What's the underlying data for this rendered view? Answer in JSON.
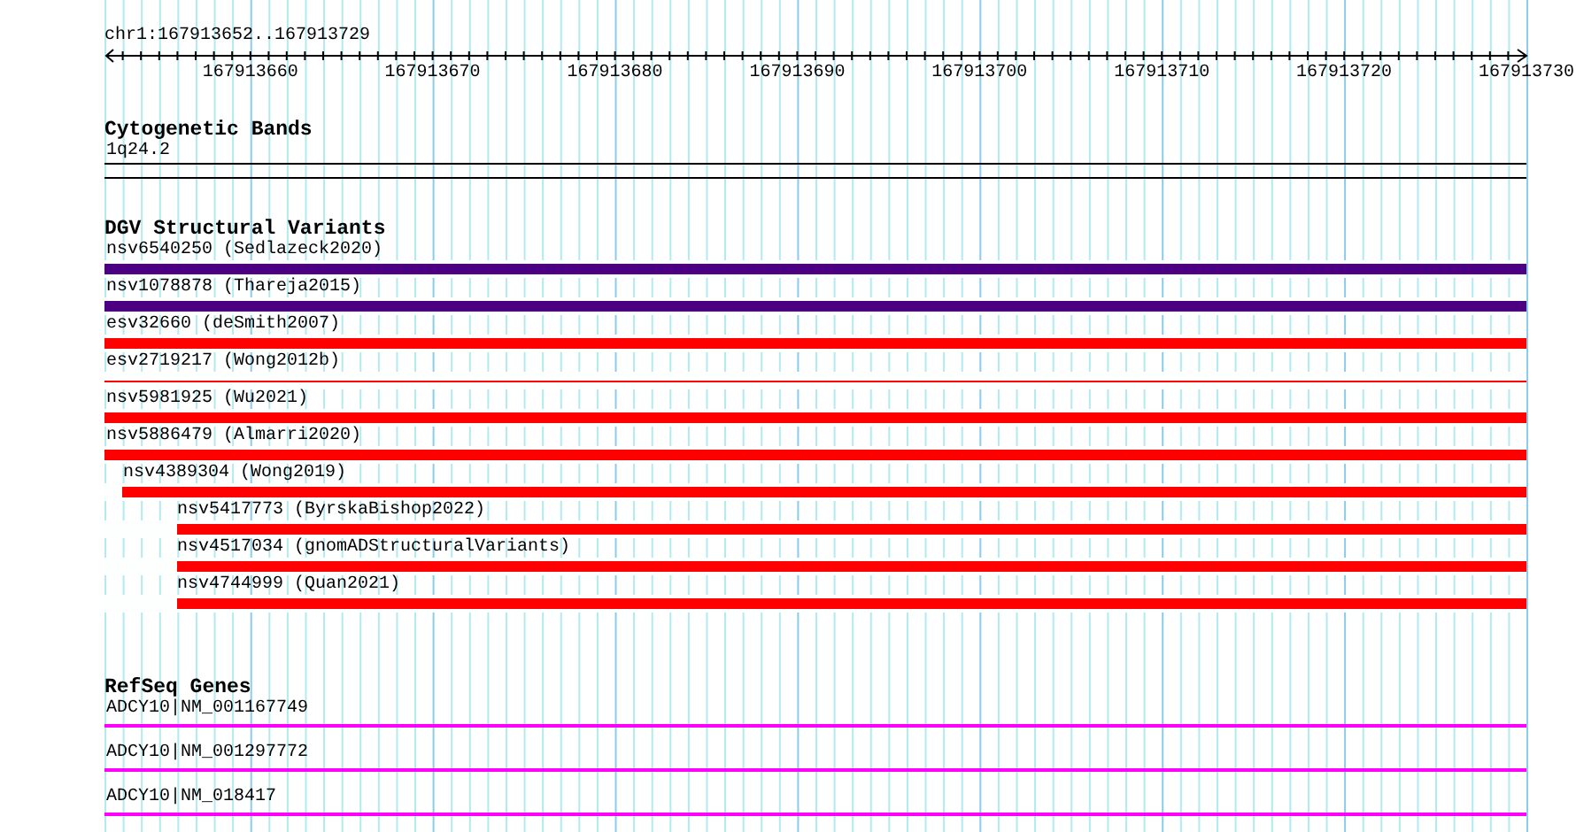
{
  "ruler": {
    "label": "chr1:167913652..167913729",
    "ticks": [
      "167913660",
      "167913670",
      "167913680",
      "167913690",
      "167913700",
      "167913710",
      "167913720",
      "167913730"
    ]
  },
  "tracks": [
    {
      "title": "Cytogenetic Bands",
      "kind": "bands",
      "features": [
        {
          "label": "1q24.2"
        }
      ]
    },
    {
      "title": "DGV Structural Variants",
      "kind": "variants",
      "features": [
        {
          "label": "nsv6540250 (Sedlazeck2020)",
          "kind": "thick",
          "color": "#4b0082"
        },
        {
          "label": "nsv1078878 (Thareja2015)",
          "kind": "thick",
          "color": "#4b0082"
        },
        {
          "label": "esv32660 (deSmith2007)",
          "kind": "thick",
          "color": "#ff0000"
        },
        {
          "label": "esv2719217 (Wong2012b)",
          "kind": "thin",
          "color": "#ff0000"
        },
        {
          "label": "nsv5981925 (Wu2021)",
          "kind": "thick",
          "color": "#ff0000"
        },
        {
          "label": "nsv5886479 (Almarri2020)",
          "kind": "thick",
          "color": "#ff0000"
        },
        {
          "label": "nsv4389304 (Wong2019)",
          "kind": "thick",
          "color": "#ff0000",
          "level": 0.987
        },
        {
          "label": "nsv5417773 (ByrskaBishop2022)",
          "kind": "thick",
          "color": "#ff0000",
          "level": 0.949
        },
        {
          "label": "nsv4517034 (gnomADStructuralVariants)",
          "kind": "thick",
          "color": "#ff0000",
          "level": 0.949
        },
        {
          "label": "nsv4744999 (Quan2021)",
          "kind": "thick",
          "color": "#ff0000",
          "level": 0.949
        }
      ]
    },
    {
      "title": "RefSeq Genes",
      "kind": "genes",
      "features": [
        {
          "label": "ADCY10|NM_001167749"
        },
        {
          "label": "ADCY10|NM_001297772"
        },
        {
          "label": "ADCY10|NM_018417"
        }
      ]
    }
  ]
}
